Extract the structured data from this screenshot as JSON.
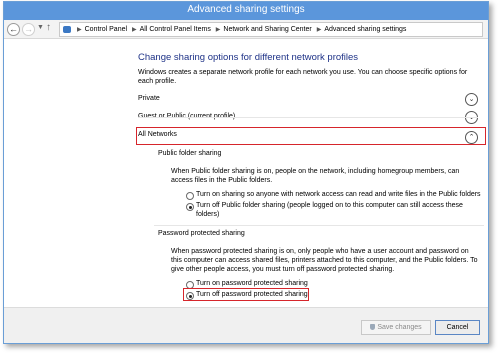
{
  "window": {
    "title": "Advanced sharing settings"
  },
  "address": {
    "crumbs": [
      "Control Panel",
      "All Control Panel Items",
      "Network and Sharing Center",
      "Advanced sharing settings"
    ]
  },
  "main": {
    "heading": "Change sharing options for different network profiles",
    "intro": "Windows creates a separate network profile for each network you use. You can choose specific options for each profile.",
    "profiles": {
      "private": "Private",
      "guest": "Guest or Public (current profile)",
      "all": "All Networks"
    },
    "public_folder": {
      "title": "Public folder sharing",
      "description": "When Public folder sharing is on, people on the network, including homegroup members, can access files in the Public folders.",
      "option_on": "Turn on sharing so anyone with network access can read and write files in the Public folders",
      "option_off": "Turn off Public folder sharing (people logged on to this computer can still access these folders)",
      "selected": "off"
    },
    "password": {
      "title": "Password protected sharing",
      "description": "When password protected sharing is on, only people who have a user account and password on this computer can access shared files, printers attached to this computer, and the Public folders. To give other people access, you must turn off password protected sharing.",
      "option_on": "Turn on password protected sharing",
      "option_off": "Turn off password protected sharing",
      "selected": "off"
    }
  },
  "footer": {
    "save_label": "Save changes",
    "cancel_label": "Cancel"
  },
  "colors": {
    "titlebar": "#5b96db",
    "heading": "#1e3287",
    "highlight": "#d6252b"
  },
  "icons": {
    "back": "back-arrow-icon",
    "forward": "forward-arrow-icon",
    "up": "up-arrow-icon",
    "control_panel": "control-panel-icon",
    "expand": "chevron-down-icon",
    "collapse": "chevron-up-icon",
    "save": "uac-shield-icon"
  }
}
